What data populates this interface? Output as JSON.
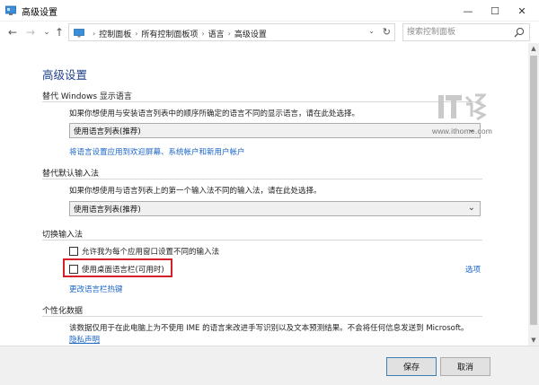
{
  "window": {
    "title": "高级设置",
    "controls": {
      "minimize": "—",
      "maximize": "☐",
      "close": "✕"
    }
  },
  "nav": {
    "back": "←",
    "forward": "→",
    "recent": "⌄",
    "up": "↑",
    "breadcrumbs": [
      "控制面板",
      "所有控制面板项",
      "语言",
      "高级设置"
    ],
    "search_placeholder": "搜索控制面板"
  },
  "main": {
    "title": "高级设置",
    "display_language": {
      "heading": "替代 Windows 显示语言",
      "description": "如果你想使用与安装语言列表中的顺序所确定的语言不同的显示语言，请在此处选择。",
      "selected": "使用语言列表(推荐)",
      "link": "将语言设置应用到欢迎屏幕、系统帐户和新用户帐户"
    },
    "default_input": {
      "heading": "替代默认输入法",
      "description": "如果你想使用与语言列表上的第一个输入法不同的输入法，请在此处选择。",
      "selected": "使用语言列表(推荐)"
    },
    "switch_input": {
      "heading": "切换输入法",
      "option_per_app": "允许我为每个应用窗口设置不同的输入法",
      "option_per_app_checked": false,
      "option_desktop_bar": "使用桌面语言栏(可用时)",
      "option_desktop_bar_checked": false,
      "options_link": "选项",
      "hotkey_link": "更改语言栏热键"
    },
    "personalization": {
      "heading": "个性化数据",
      "description": "该数据仅用于在此电脑上为不使用 IME 的语言来改进手写识别以及文本预测结果。不会将任何信息发送到 Microsoft。",
      "privacy_link": "隐私声明"
    }
  },
  "watermark": {
    "url": "www.ithome.com"
  },
  "footer": {
    "save": "保存",
    "cancel": "取消"
  },
  "colors": {
    "title_blue": "#1e3f8a",
    "link_blue": "#1a64c8",
    "highlight_red": "#d4202a"
  }
}
